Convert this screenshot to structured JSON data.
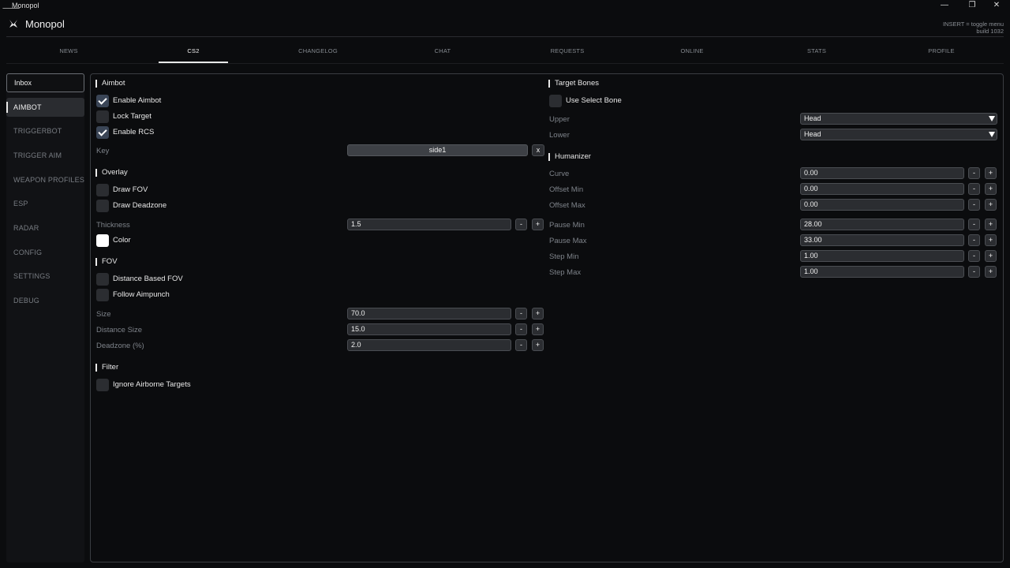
{
  "window": {
    "title": "Monopol",
    "minimize": "—",
    "restore": "❐",
    "close": "✕"
  },
  "header": {
    "title": "Monopol",
    "hint": "INSERT = toggle menu",
    "build": "build 1032"
  },
  "tabs": [
    "NEWS",
    "CS2",
    "CHANGELOG",
    "CHAT",
    "REQUESTS",
    "ONLINE",
    "STATS",
    "PROFILE"
  ],
  "active_tab": "CS2",
  "sidebar": {
    "inbox": "Inbox",
    "items": [
      "AIMBOT",
      "TRIGGERBOT",
      "TRIGGER AIM",
      "WEAPON PROFILES",
      "ESP",
      "RADAR",
      "CONFIG",
      "SETTINGS",
      "DEBUG"
    ],
    "active": "AIMBOT"
  },
  "aimbot": {
    "section": "Aimbot",
    "enable_aimbot": {
      "label": "Enable Aimbot",
      "checked": true
    },
    "lock_target": {
      "label": "Lock Target",
      "checked": false
    },
    "enable_rcs": {
      "label": "Enable RCS",
      "checked": true
    },
    "key_label": "Key",
    "key_value": "side1",
    "key_clear": "x"
  },
  "overlay": {
    "section": "Overlay",
    "draw_fov": {
      "label": "Draw FOV",
      "checked": false
    },
    "draw_deadzone": {
      "label": "Draw Deadzone",
      "checked": false
    },
    "thickness_label": "Thickness",
    "thickness_value": "1.5",
    "color_label": "Color",
    "color_value": "#ffffff"
  },
  "fov": {
    "section": "FOV",
    "distance_based": {
      "label": "Distance Based FOV",
      "checked": false
    },
    "follow_aimpunch": {
      "label": "Follow Aimpunch",
      "checked": false
    },
    "size_label": "Size",
    "size_value": "70.0",
    "distance_size_label": "Distance Size",
    "distance_size_value": "15.0",
    "deadzone_label": "Deadzone (%)",
    "deadzone_value": "2.0"
  },
  "filter": {
    "section": "Filter",
    "ignore_airborne": {
      "label": "Ignore Airborne Targets",
      "checked": false
    }
  },
  "target_bones": {
    "section": "Target Bones",
    "use_select_bone": {
      "label": "Use Select Bone",
      "checked": false
    },
    "upper_label": "Upper",
    "upper_value": "Head",
    "lower_label": "Lower",
    "lower_value": "Head"
  },
  "humanizer": {
    "section": "Humanizer",
    "rows": [
      {
        "label": "Curve",
        "value": "0.00"
      },
      {
        "label": "Offset Min",
        "value": "0.00"
      },
      {
        "label": "Offset Max",
        "value": "0.00"
      },
      {
        "label": "Pause Min",
        "value": "28.00"
      },
      {
        "label": "Pause Max",
        "value": "33.00"
      },
      {
        "label": "Step Min",
        "value": "1.00"
      },
      {
        "label": "Step Max",
        "value": "1.00"
      }
    ]
  },
  "stepper": {
    "minus": "-",
    "plus": "+"
  },
  "colors": {
    "background": "#0b0c0e",
    "accent": "#e8e8e8",
    "checkbox_on": "#3a4556"
  }
}
